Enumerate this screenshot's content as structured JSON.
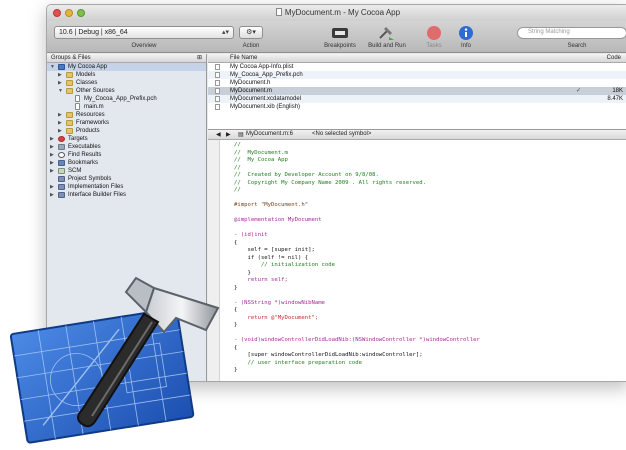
{
  "window": {
    "title": "MyDocument.m - My Cocoa App",
    "traffic_lights": {
      "close": "#e0524c",
      "minimize": "#e6b43a",
      "zoom": "#7fbf4d"
    }
  },
  "toolbar": {
    "sdk_value": "10.6 | Debug | x86_64",
    "overview_label": "Overview",
    "action_label": "Action",
    "breakpoints_label": "Breakpoints",
    "build_and_run_label": "Build and Run",
    "tasks_label": "Tasks",
    "info_label": "Info",
    "search_placeholder": "String Matching",
    "search_label": "Search"
  },
  "sidebar": {
    "header": "Groups & Files",
    "items": [
      {
        "label": "My Cocoa App",
        "icon": "project-icon"
      },
      {
        "label": "Models",
        "icon": "folder-icon"
      },
      {
        "label": "Classes",
        "icon": "folder-icon"
      },
      {
        "label": "Other Sources",
        "icon": "folder-icon"
      },
      {
        "label": "My_Cocoa_App_Prefix.pch",
        "icon": "file-icon"
      },
      {
        "label": "main.m",
        "icon": "file-icon"
      },
      {
        "label": "Resources",
        "icon": "folder-icon"
      },
      {
        "label": "Frameworks",
        "icon": "folder-icon"
      },
      {
        "label": "Products",
        "icon": "folder-icon"
      },
      {
        "label": "Targets",
        "icon": "target-icon"
      },
      {
        "label": "Executables",
        "icon": "executable-icon"
      },
      {
        "label": "Find Results",
        "icon": "find-icon"
      },
      {
        "label": "Bookmarks",
        "icon": "bookmark-icon"
      },
      {
        "label": "SCM",
        "icon": "scm-icon"
      },
      {
        "label": "Project Symbols",
        "icon": "symbols-icon"
      },
      {
        "label": "Implementation Files",
        "icon": "implementation-icon"
      },
      {
        "label": "Interface Builder Files",
        "icon": "interface-icon"
      }
    ]
  },
  "file_list": {
    "col_name": "File Name",
    "col_code": "Code",
    "rows": [
      {
        "name": "My Cocoa App-Info.plist",
        "check": "",
        "code": ""
      },
      {
        "name": "My_Cocoa_App_Prefix.pch",
        "check": "",
        "code": ""
      },
      {
        "name": "MyDocument.h",
        "check": "",
        "code": ""
      },
      {
        "name": "MyDocument.m",
        "check": "✓",
        "code": "18K"
      },
      {
        "name": "MyDocument.xcdatamodel",
        "check": "",
        "code": "8.47K"
      },
      {
        "name": "MyDocument.xib (English)",
        "check": "",
        "code": ""
      }
    ]
  },
  "editor": {
    "file_label": "MyDocument.m:6",
    "symbol_label": "<No selected symbol>",
    "code_lines": [
      {
        "t": "//",
        "c": "comment"
      },
      {
        "t": "//  MyDocument.m",
        "c": "comment"
      },
      {
        "t": "//  My Cocoa App",
        "c": "comment"
      },
      {
        "t": "//",
        "c": "comment"
      },
      {
        "t": "//  Created by Developer Account on 9/8/08.",
        "c": "comment"
      },
      {
        "t": "//  Copyright My Company Name 2009 . All rights reserved.",
        "c": "comment"
      },
      {
        "t": "//",
        "c": "comment"
      },
      {
        "t": "",
        "c": "plain"
      },
      {
        "t": "#import \"MyDocument.h\"",
        "c": "pre"
      },
      {
        "t": "",
        "c": "plain"
      },
      {
        "t": "@implementation MyDocument",
        "c": "kw"
      },
      {
        "t": "",
        "c": "plain"
      },
      {
        "t": "- (id)init",
        "c": "kw"
      },
      {
        "t": "{",
        "c": "plain"
      },
      {
        "t": "    self = [super init];",
        "c": "plain"
      },
      {
        "t": "    if (self != nil) {",
        "c": "plain"
      },
      {
        "t": "        // initialization code",
        "c": "comment"
      },
      {
        "t": "    }",
        "c": "plain"
      },
      {
        "t": "    return self;",
        "c": "kw"
      },
      {
        "t": "}",
        "c": "plain"
      },
      {
        "t": "",
        "c": "plain"
      },
      {
        "t": "- (NSString *)windowNibName",
        "c": "kw"
      },
      {
        "t": "{",
        "c": "plain"
      },
      {
        "t": "    return @\"MyDocument\";",
        "c": "str"
      },
      {
        "t": "}",
        "c": "plain"
      },
      {
        "t": "",
        "c": "plain"
      },
      {
        "t": "- (void)windowControllerDidLoadNib:(NSWindowController *)windowController",
        "c": "kw"
      },
      {
        "t": "{",
        "c": "plain"
      },
      {
        "t": "    [super windowControllerDidLoadNib:windowController];",
        "c": "plain"
      },
      {
        "t": "    // user interface preparation code",
        "c": "comment"
      },
      {
        "t": "}",
        "c": "plain"
      }
    ]
  },
  "colors": {
    "selection": "#c6d3e7",
    "comment": "#1e7f1e",
    "keyword": "#a12a99",
    "string": "#c22f2f",
    "icon_blueprint": "#2f6fd1"
  },
  "decor": {
    "icon": "xcode-hammer-blueprint-icon"
  }
}
